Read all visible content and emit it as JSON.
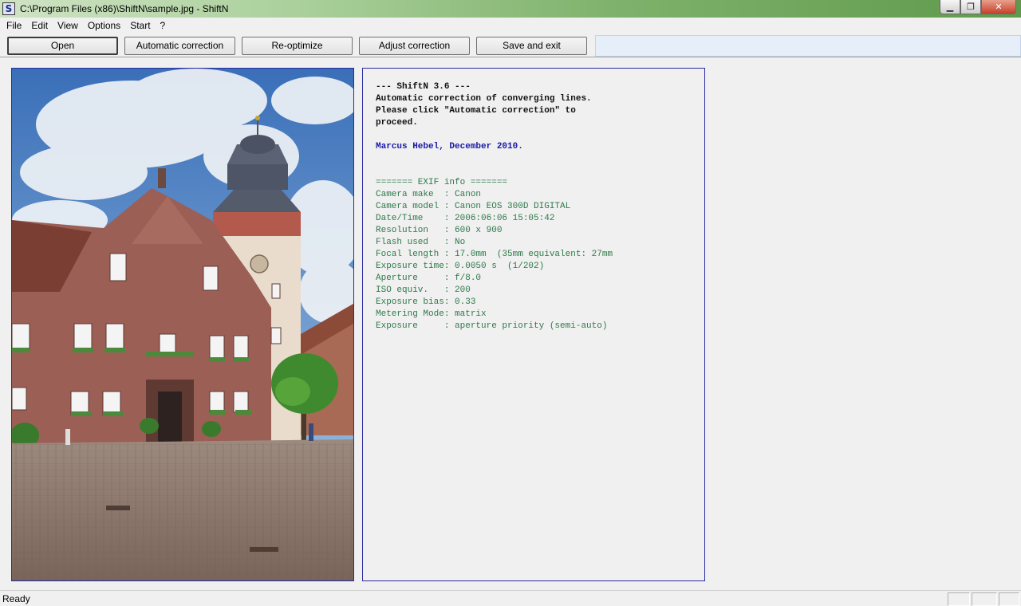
{
  "window": {
    "icon_letter": "S",
    "title": "C:\\Program Files (x86)\\ShiftN\\sample.jpg - ShiftN",
    "controls": {
      "minimize": "▁",
      "maximize": "❐",
      "close": "✕"
    }
  },
  "menu": [
    "File",
    "Edit",
    "View",
    "Options",
    "Start",
    "?"
  ],
  "toolbar": {
    "buttons": [
      "Open",
      "Automatic correction",
      "Re-optimize",
      "Adjust correction",
      "Save and exit"
    ]
  },
  "info": {
    "header": [
      "--- ShiftN 3.6 ---",
      "Automatic correction of converging lines.",
      "Please click \"Automatic correction\" to",
      "proceed."
    ],
    "author": "Marcus Hebel, December 2010.",
    "exif": [
      "======= EXIF info =======",
      "Camera make  : Canon",
      "Camera model : Canon EOS 300D DIGITAL",
      "Date/Time    : 2006:06:06 15:05:42",
      "Resolution   : 600 x 900",
      "Flash used   : No",
      "Focal length : 17.0mm  (35mm equivalent: 27mm",
      "Exposure time: 0.0050 s  (1/202)",
      "Aperture     : f/8.0",
      "ISO equiv.   : 200",
      "Exposure bias: 0.33",
      "Metering Mode: matrix",
      "Exposure     : aperture priority (semi-auto)"
    ]
  },
  "status": {
    "text": "Ready"
  },
  "colors": {
    "frame_border": "#2a2aa0",
    "header_text": "#111111",
    "author_text": "#1a1aa8",
    "exif_text": "#2d7a4a"
  }
}
